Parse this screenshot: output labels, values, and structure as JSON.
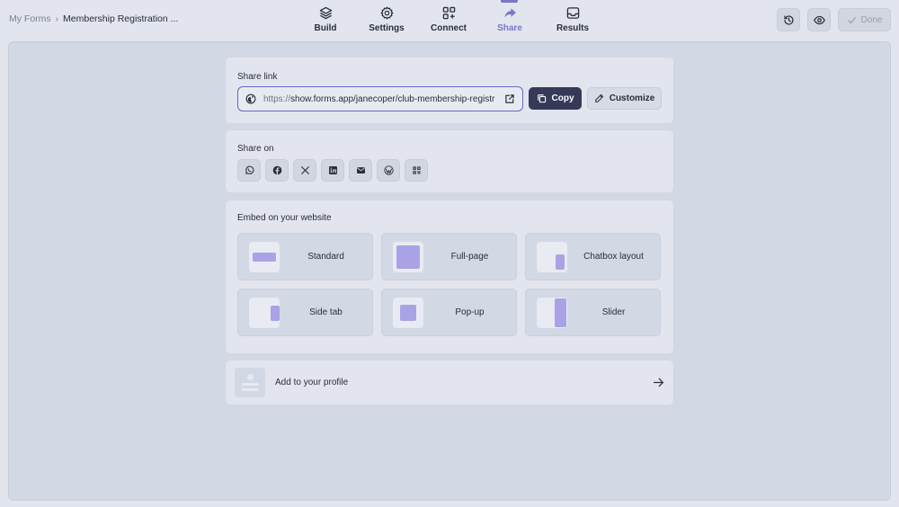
{
  "breadcrumb": {
    "root": "My Forms",
    "separator": "›",
    "current": "Membership Registration ..."
  },
  "nav": {
    "items": [
      {
        "label": "Build",
        "icon": "layers-icon",
        "active": false
      },
      {
        "label": "Settings",
        "icon": "gear-icon",
        "active": false
      },
      {
        "label": "Connect",
        "icon": "grid-plus-icon",
        "active": false
      },
      {
        "label": "Share",
        "icon": "share-arrow-icon",
        "active": true
      },
      {
        "label": "Results",
        "icon": "inbox-icon",
        "active": false
      }
    ]
  },
  "actions": {
    "history_icon": "history-icon",
    "preview_icon": "eye-icon",
    "done_label": "Done"
  },
  "share_link": {
    "title": "Share link",
    "url_protocol": "https://",
    "url_rest": "show.forms.app/janecoper/club-membership-registr",
    "copy_label": "Copy",
    "customize_label": "Customize"
  },
  "share_on": {
    "title": "Share on",
    "platforms": [
      "whatsapp-icon",
      "facebook-icon",
      "x-icon",
      "linkedin-icon",
      "email-icon",
      "wordpress-icon",
      "qr-code-icon"
    ]
  },
  "embed": {
    "title": "Embed on your website",
    "options": [
      {
        "label": "Standard"
      },
      {
        "label": "Full-page"
      },
      {
        "label": "Chatbox layout"
      },
      {
        "label": "Side tab"
      },
      {
        "label": "Pop-up"
      },
      {
        "label": "Slider"
      }
    ]
  },
  "profile": {
    "label": "Add to your profile"
  },
  "colors": {
    "accent": "#7b76c8",
    "primary_button": "#363a58",
    "embed_shape": "#a9a3e6"
  }
}
